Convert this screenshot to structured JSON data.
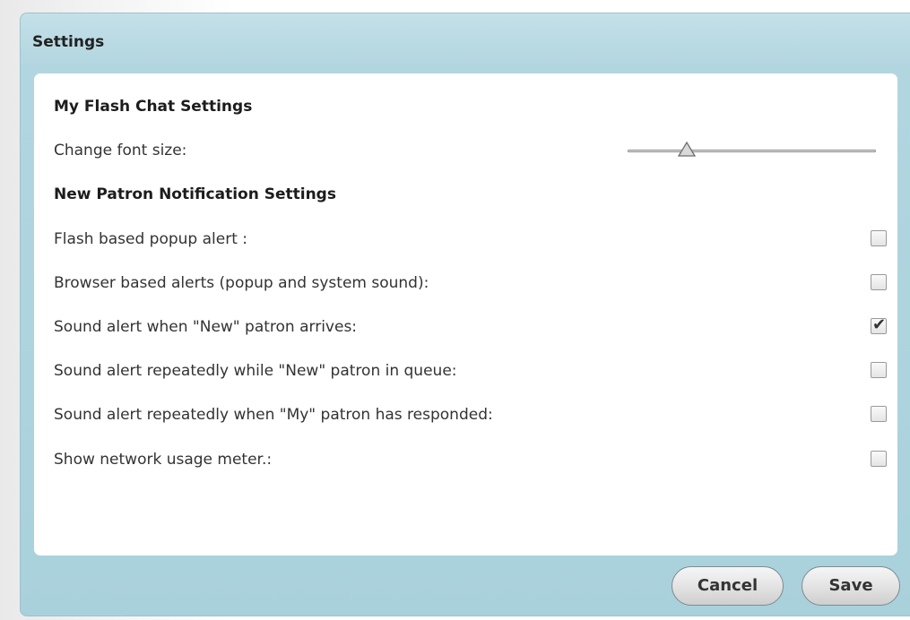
{
  "dialog": {
    "title": "Settings"
  },
  "flash_chat": {
    "heading": "My Flash Chat Settings",
    "font_size_label": "Change font size:",
    "font_size_slider_level": 0.24
  },
  "notifications": {
    "heading": "New Patron Notification Settings",
    "options": [
      {
        "label": "Flash based popup alert :",
        "checked": false
      },
      {
        "label": "Browser based alerts (popup and system sound):",
        "checked": false
      },
      {
        "label": "Sound alert when \"New\" patron arrives:",
        "checked": true
      },
      {
        "label": "Sound alert repeatedly while \"New\" patron in queue:",
        "checked": false
      },
      {
        "label": "Sound alert repeatedly when \"My\" patron has responded:",
        "checked": false
      },
      {
        "label": "Show network usage meter.:",
        "checked": false
      }
    ]
  },
  "buttons": {
    "cancel_label": "Cancel",
    "save_label": "Save"
  },
  "icons": {
    "checkbox_checked": "check-icon",
    "slider_thumb": "triangle-thumb-icon"
  }
}
